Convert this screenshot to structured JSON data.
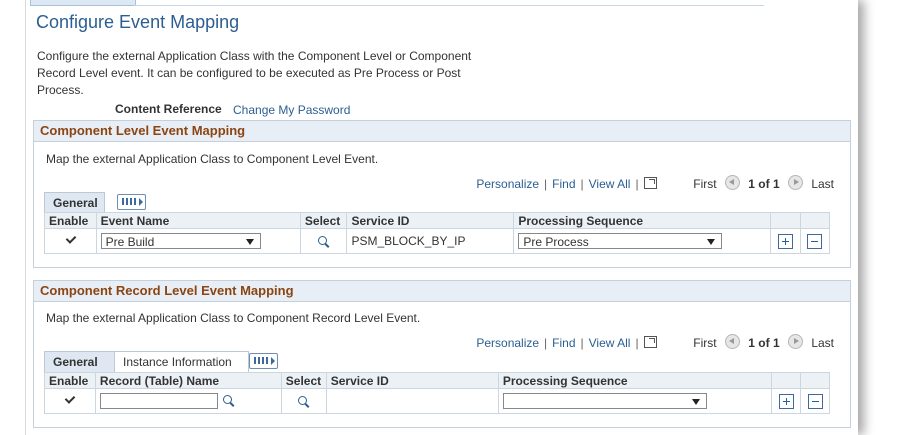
{
  "page": {
    "title": "Configure Event Mapping",
    "description": "Configure the external Application Class with the Component Level or Component Record Level event. It can be configured to be executed as Pre Process or Post Process.",
    "content_reference_label": "Content Reference",
    "content_reference_value": "Change My Password"
  },
  "navbar": {
    "personalize": "Personalize",
    "find": "Find",
    "view_all": "View All",
    "first": "First",
    "count": "1 of 1",
    "last": "Last"
  },
  "component_level": {
    "header": "Component Level Event Mapping",
    "desc": "Map the external Application Class to Component Level Event.",
    "tabs": [
      "General"
    ],
    "columns": [
      "Enable",
      "Event Name",
      "Select",
      "Service ID",
      "Processing Sequence"
    ],
    "row": {
      "enable": true,
      "event_name": "Pre Build",
      "service_id": "PSM_BLOCK_BY_IP",
      "processing_sequence": "Pre Process"
    }
  },
  "record_level": {
    "header": "Component Record Level Event Mapping",
    "desc": "Map the external Application Class to Component Record Level Event.",
    "tabs": [
      "General",
      "Instance Information"
    ],
    "columns": [
      "Enable",
      "Record (Table) Name",
      "Select",
      "Service ID",
      "Processing Sequence"
    ],
    "row": {
      "enable": true,
      "record_name": "",
      "service_id": "",
      "processing_sequence": ""
    }
  }
}
